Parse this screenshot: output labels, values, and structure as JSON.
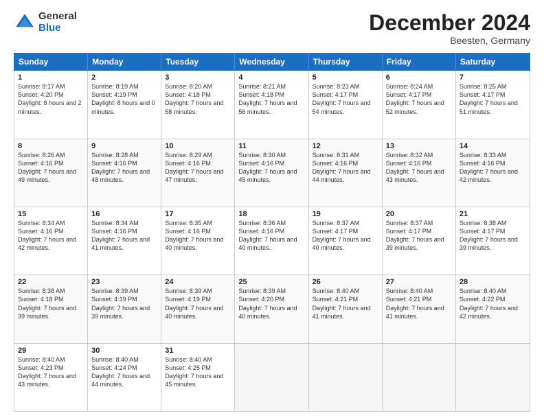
{
  "logo": {
    "general": "General",
    "blue": "Blue"
  },
  "title": "December 2024",
  "subtitle": "Beesten, Germany",
  "days": [
    "Sunday",
    "Monday",
    "Tuesday",
    "Wednesday",
    "Thursday",
    "Friday",
    "Saturday"
  ],
  "weeks": [
    [
      {
        "day": 1,
        "sunrise": "8:17 AM",
        "sunset": "4:20 PM",
        "daylight": "8 hours and 2 minutes."
      },
      {
        "day": 2,
        "sunrise": "8:19 AM",
        "sunset": "4:19 PM",
        "daylight": "8 hours and 0 minutes."
      },
      {
        "day": 3,
        "sunrise": "8:20 AM",
        "sunset": "4:18 PM",
        "daylight": "7 hours and 58 minutes."
      },
      {
        "day": 4,
        "sunrise": "8:21 AM",
        "sunset": "4:18 PM",
        "daylight": "7 hours and 56 minutes."
      },
      {
        "day": 5,
        "sunrise": "8:23 AM",
        "sunset": "4:17 PM",
        "daylight": "7 hours and 54 minutes."
      },
      {
        "day": 6,
        "sunrise": "8:24 AM",
        "sunset": "4:17 PM",
        "daylight": "7 hours and 52 minutes."
      },
      {
        "day": 7,
        "sunrise": "8:25 AM",
        "sunset": "4:17 PM",
        "daylight": "7 hours and 51 minutes."
      }
    ],
    [
      {
        "day": 8,
        "sunrise": "8:26 AM",
        "sunset": "4:16 PM",
        "daylight": "7 hours and 49 minutes."
      },
      {
        "day": 9,
        "sunrise": "8:28 AM",
        "sunset": "4:16 PM",
        "daylight": "7 hours and 48 minutes."
      },
      {
        "day": 10,
        "sunrise": "8:29 AM",
        "sunset": "4:16 PM",
        "daylight": "7 hours and 47 minutes."
      },
      {
        "day": 11,
        "sunrise": "8:30 AM",
        "sunset": "4:16 PM",
        "daylight": "7 hours and 45 minutes."
      },
      {
        "day": 12,
        "sunrise": "8:31 AM",
        "sunset": "4:16 PM",
        "daylight": "7 hours and 44 minutes."
      },
      {
        "day": 13,
        "sunrise": "8:32 AM",
        "sunset": "4:16 PM",
        "daylight": "7 hours and 43 minutes."
      },
      {
        "day": 14,
        "sunrise": "8:33 AM",
        "sunset": "4:16 PM",
        "daylight": "7 hours and 42 minutes."
      }
    ],
    [
      {
        "day": 15,
        "sunrise": "8:34 AM",
        "sunset": "4:16 PM",
        "daylight": "7 hours and 42 minutes."
      },
      {
        "day": 16,
        "sunrise": "8:34 AM",
        "sunset": "4:16 PM",
        "daylight": "7 hours and 41 minutes."
      },
      {
        "day": 17,
        "sunrise": "8:35 AM",
        "sunset": "4:16 PM",
        "daylight": "7 hours and 40 minutes."
      },
      {
        "day": 18,
        "sunrise": "8:36 AM",
        "sunset": "4:16 PM",
        "daylight": "7 hours and 40 minutes."
      },
      {
        "day": 19,
        "sunrise": "8:37 AM",
        "sunset": "4:17 PM",
        "daylight": "7 hours and 40 minutes."
      },
      {
        "day": 20,
        "sunrise": "8:37 AM",
        "sunset": "4:17 PM",
        "daylight": "7 hours and 39 minutes."
      },
      {
        "day": 21,
        "sunrise": "8:38 AM",
        "sunset": "4:17 PM",
        "daylight": "7 hours and 39 minutes."
      }
    ],
    [
      {
        "day": 22,
        "sunrise": "8:38 AM",
        "sunset": "4:18 PM",
        "daylight": "7 hours and 39 minutes."
      },
      {
        "day": 23,
        "sunrise": "8:39 AM",
        "sunset": "4:19 PM",
        "daylight": "7 hours and 39 minutes."
      },
      {
        "day": 24,
        "sunrise": "8:39 AM",
        "sunset": "4:19 PM",
        "daylight": "7 hours and 40 minutes."
      },
      {
        "day": 25,
        "sunrise": "8:39 AM",
        "sunset": "4:20 PM",
        "daylight": "7 hours and 40 minutes."
      },
      {
        "day": 26,
        "sunrise": "8:40 AM",
        "sunset": "4:21 PM",
        "daylight": "7 hours and 41 minutes."
      },
      {
        "day": 27,
        "sunrise": "8:40 AM",
        "sunset": "4:21 PM",
        "daylight": "7 hours and 41 minutes."
      },
      {
        "day": 28,
        "sunrise": "8:40 AM",
        "sunset": "4:22 PM",
        "daylight": "7 hours and 42 minutes."
      }
    ],
    [
      {
        "day": 29,
        "sunrise": "8:40 AM",
        "sunset": "4:23 PM",
        "daylight": "7 hours and 43 minutes."
      },
      {
        "day": 30,
        "sunrise": "8:40 AM",
        "sunset": "4:24 PM",
        "daylight": "7 hours and 44 minutes."
      },
      {
        "day": 31,
        "sunrise": "8:40 AM",
        "sunset": "4:25 PM",
        "daylight": "7 hours and 45 minutes."
      },
      null,
      null,
      null,
      null
    ]
  ],
  "labels": {
    "sunrise": "Sunrise:",
    "sunset": "Sunset:",
    "daylight": "Daylight:"
  }
}
